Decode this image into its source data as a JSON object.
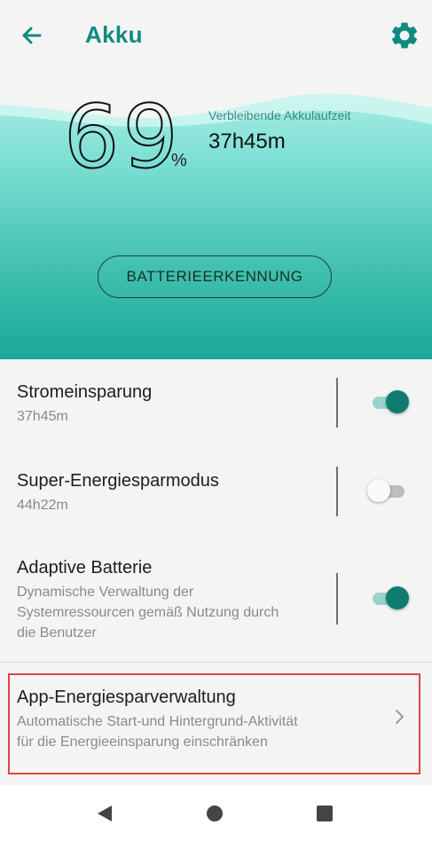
{
  "app_bar": {
    "title": "Akku",
    "back_icon": "arrow-back-icon",
    "settings_icon": "gear-icon",
    "accent_color": "#0f8a7c"
  },
  "battery": {
    "percent": "69",
    "percent_sign": "%",
    "remaining_label": "Verbleibende Akkulaufzeit",
    "remaining_value": "37h45m",
    "detect_button": "BATTERIEERKENNUNG"
  },
  "settings": [
    {
      "label": "Stromeinsparung",
      "sub": "37h45m",
      "toggle": true
    },
    {
      "label": "Super-Energiesparmodus",
      "sub": "44h22m",
      "toggle": false
    },
    {
      "label": "Adaptive Batterie",
      "sub_lines": [
        "Dynamische Verwaltung der",
        "Systemressourcen gemäß Nutzung durch",
        "die Benutzer"
      ],
      "toggle": true
    }
  ],
  "app_manager": {
    "label": "App-Energiesparverwaltung",
    "sub_lines": [
      "Automatische Start-und Hintergrund-Aktivität",
      "für die Energieeinsparung einschränken"
    ]
  },
  "nav": {
    "back_icon": "triangle-back-icon",
    "home_icon": "circle-home-icon",
    "recents_icon": "square-recents-icon"
  }
}
